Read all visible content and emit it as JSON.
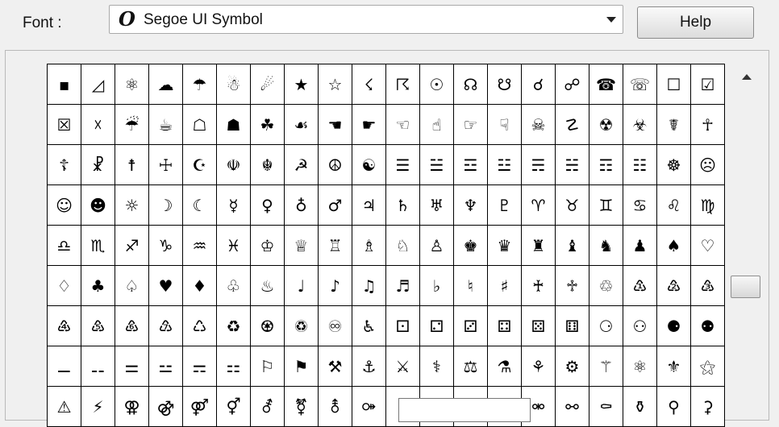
{
  "window": {
    "font_label": "Font :",
    "font_type_icon": "opentype-icon",
    "font_type_glyph": "O",
    "selected_font": "Segoe UI Symbol",
    "help_label": "Help"
  },
  "grid": {
    "columns": 20,
    "rows": [
      [
        "▪",
        "◿",
        "⚛",
        "☁",
        "☂",
        "☃",
        "☄",
        "★",
        "☆",
        "☇",
        "☈",
        "☉",
        "☊",
        "☋",
        "☌",
        "☍",
        "☎",
        "☏",
        "☐",
        "☑"
      ],
      [
        "☒",
        "☓",
        "☔",
        "☕",
        "☖",
        "☗",
        "☘",
        "☙",
        "☚",
        "☛",
        "☜",
        "☝",
        "☞",
        "☟",
        "☠",
        "☡",
        "☢",
        "☣",
        "☤",
        "☥"
      ],
      [
        "☦",
        "☧",
        "☨",
        "☩",
        "☪",
        "☫",
        "☬",
        "☭",
        "☮",
        "☯",
        "☰",
        "☱",
        "☲",
        "☳",
        "☴",
        "☵",
        "☶",
        "☷",
        "☸",
        "☹"
      ],
      [
        "☺",
        "☻",
        "☼",
        "☽",
        "☾",
        "☿",
        "♀",
        "♁",
        "♂",
        "♃",
        "♄",
        "♅",
        "♆",
        "♇",
        "♈",
        "♉",
        "♊",
        "♋",
        "♌",
        "♍"
      ],
      [
        "♎",
        "♏",
        "♐",
        "♑",
        "♒",
        "♓",
        "♔",
        "♕",
        "♖",
        "♗",
        "♘",
        "♙",
        "♚",
        "♛",
        "♜",
        "♝",
        "♞",
        "♟",
        "♠",
        "♡"
      ],
      [
        "♢",
        "♣",
        "♤",
        "♥",
        "♦",
        "♧",
        "♨",
        "♩",
        "♪",
        "♫",
        "♬",
        "♭",
        "♮",
        "♯",
        "♰",
        "♱",
        "♲",
        "♳",
        "♴",
        "♵"
      ],
      [
        "♶",
        "♷",
        "♸",
        "♹",
        "♺",
        "♻",
        "♼",
        "♽",
        "♾",
        "♿",
        "⚀",
        "⚁",
        "⚂",
        "⚃",
        "⚄",
        "⚅",
        "⚆",
        "⚇",
        "⚈",
        "⚉"
      ],
      [
        "⚊",
        "⚋",
        "⚌",
        "⚍",
        "⚎",
        "⚏",
        "⚐",
        "⚑",
        "⚒",
        "⚓",
        "⚔",
        "⚕",
        "⚖",
        "⚗",
        "⚘",
        "⚙",
        "⚚",
        "⚛",
        "⚜",
        "⚝"
      ],
      [
        "⚠",
        "⚡",
        "⚢",
        "⚣",
        "⚤",
        "⚥",
        "⚦",
        "⚧",
        "⚨",
        "⚩",
        "⚪",
        "⚫",
        "⚬",
        "⚭",
        "⚮",
        "⚯",
        "⚰",
        "⚱",
        "⚲",
        "⚳"
      ]
    ]
  }
}
